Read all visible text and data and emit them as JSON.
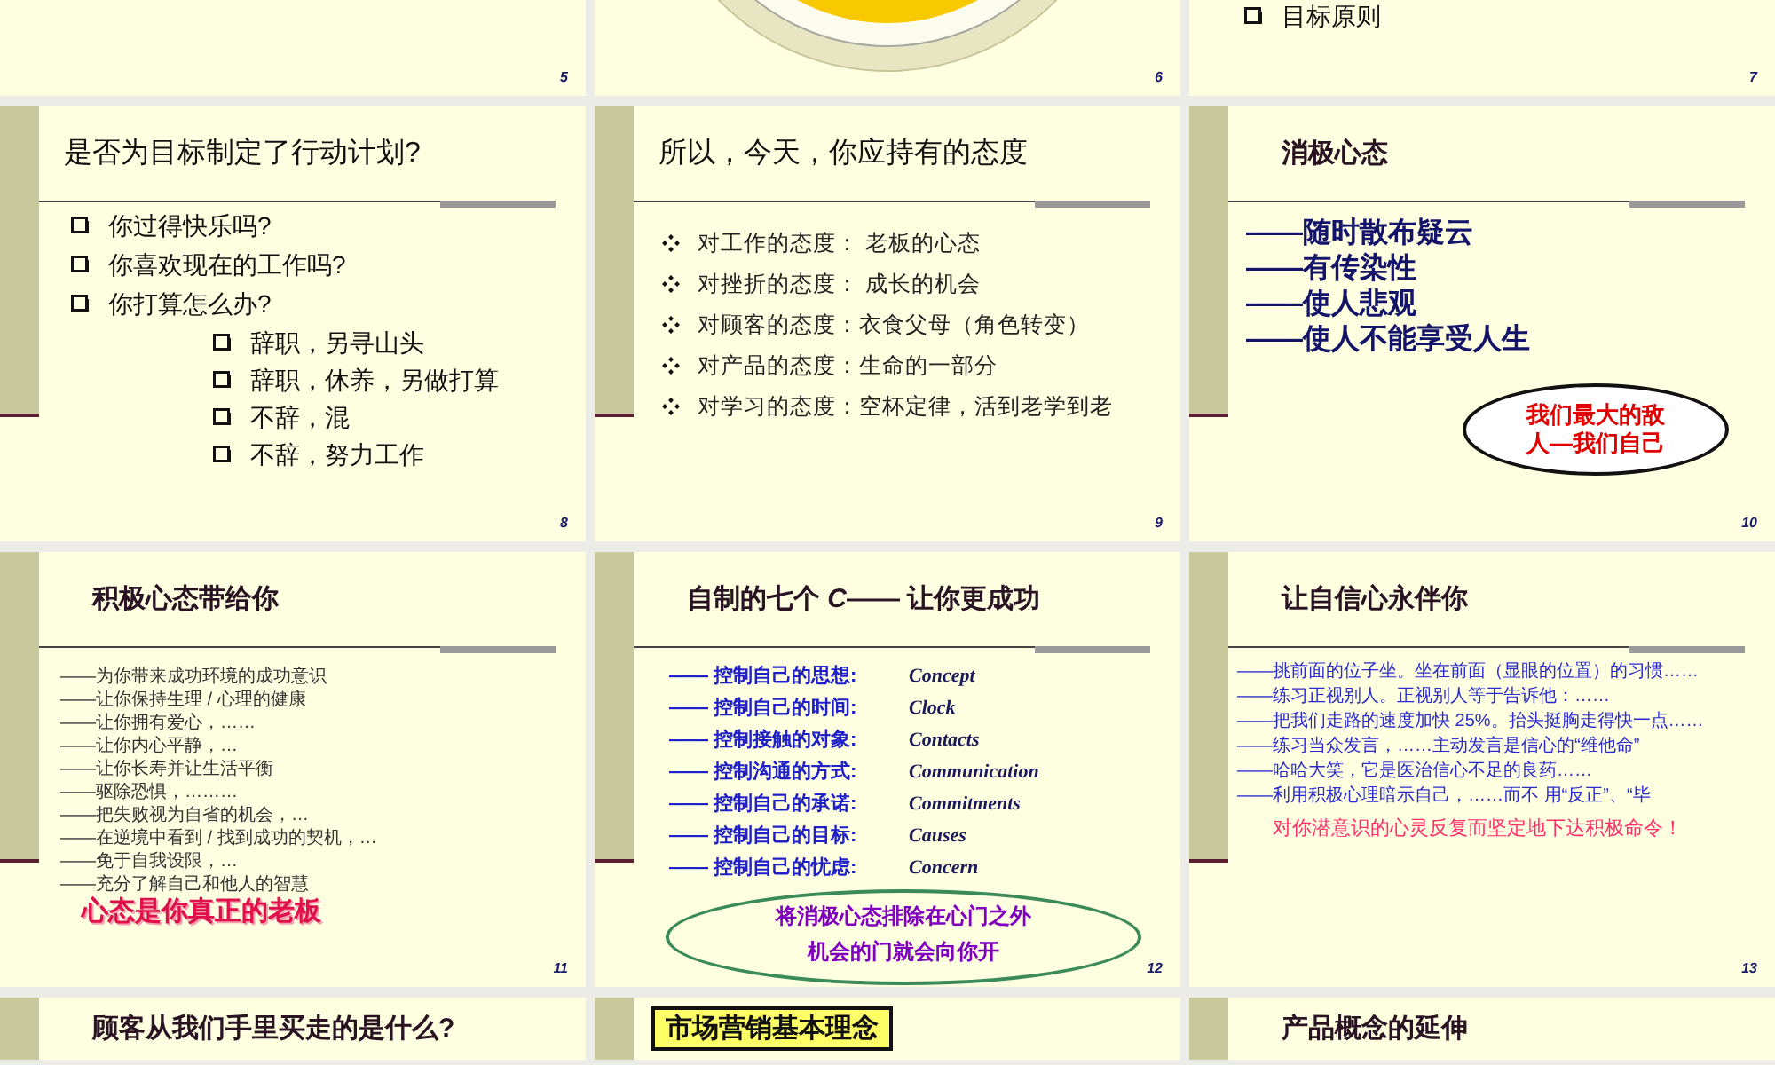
{
  "slides": [
    {
      "number": "5",
      "kind": "blank"
    },
    {
      "number": "6",
      "kind": "rings"
    },
    {
      "number": "7",
      "kind": "list",
      "body": {
        "kind": "medium",
        "items": [
          {
            "kind": "box-bullet",
            "text": "目标原则"
          }
        ]
      }
    },
    {
      "number": "8",
      "kind": "list",
      "title": {
        "kind": "plain",
        "text": "是否为目标制定了行动计划?"
      },
      "body": {
        "kind": "medium",
        "items": [
          {
            "kind": "box-bullet",
            "text": "你过得快乐吗?"
          },
          {
            "kind": "box-bullet",
            "text": "你喜欢现在的工作吗?"
          },
          {
            "kind": "box-bullet",
            "text": "你打算怎么办?",
            "children": [
              {
                "kind": "box-bullet",
                "text": "辞职，另寻山头"
              },
              {
                "kind": "box-bullet",
                "text": "辞职，休养，另做打算"
              },
              {
                "kind": "box-bullet",
                "text": "不辞，混"
              },
              {
                "kind": "box-bullet",
                "text": "不辞，努力工作"
              }
            ]
          }
        ]
      }
    },
    {
      "number": "9",
      "kind": "list",
      "title": {
        "kind": "plain",
        "text": "所以，今天，你应持有的态度"
      },
      "body": {
        "kind": "regular",
        "items": [
          {
            "kind": "diamond-bullet",
            "text": "对工作的态度： 老板的心态"
          },
          {
            "kind": "diamond-bullet",
            "text": "对挫折的态度： 成长的机会"
          },
          {
            "kind": "diamond-bullet",
            "text": "对顾客的态度：衣食父母（角色转变）"
          },
          {
            "kind": "diamond-bullet",
            "text": "对产品的态度：生命的一部分"
          },
          {
            "kind": "diamond-bullet",
            "text": "对学习的态度：空杯定律，活到老学到老"
          }
        ]
      }
    },
    {
      "number": "10",
      "kind": "list",
      "title": {
        "kind": "bold",
        "text": "消极心态"
      },
      "body": {
        "kind": "large-bold",
        "items": [
          {
            "kind": "dash",
            "text": "——随时散布疑云"
          },
          {
            "kind": "dash",
            "text": "——有传染性"
          },
          {
            "kind": "dash",
            "text": "——使人悲观"
          },
          {
            "kind": "dash",
            "text": "——使人不能享受人生"
          },
          {
            "kind": "oval-callout",
            "lines": [
              "我们最大的敌",
              "人—我们自己"
            ]
          }
        ]
      }
    },
    {
      "number": "11",
      "kind": "list",
      "title": {
        "kind": "bold",
        "text": "积极心态带给你"
      },
      "body": {
        "kind": "small",
        "items": [
          {
            "kind": "dash",
            "text": "——为你带来成功环境的成功意识"
          },
          {
            "kind": "dash",
            "text": "——让你保持生理 / 心理的健康"
          },
          {
            "kind": "dash",
            "text": "——让你拥有爱心，……"
          },
          {
            "kind": "dash",
            "text": "——让你内心平静，…"
          },
          {
            "kind": "dash",
            "text": "——让你长寿并让生活平衡"
          },
          {
            "kind": "dash",
            "text": "——驱除恐惧，………"
          },
          {
            "kind": "dash",
            "text": "——把失败视为自省的机会，…"
          },
          {
            "kind": "dash",
            "text": "——在逆境中看到 / 找到成功的契机，…"
          },
          {
            "kind": "dash",
            "text": "——免于自我设限，…"
          },
          {
            "kind": "dash",
            "text": "——充分了解自己和他人的智慧"
          },
          {
            "kind": "emphasis",
            "text": "心态是你真正的老板"
          }
        ]
      }
    },
    {
      "number": "12",
      "kind": "list",
      "title": {
        "kind": "bold",
        "text": "自制的七个 *C*—— 让你更成功"
      },
      "body": {
        "kind": "bold-blue",
        "items": [
          {
            "kind": "dash-term",
            "text": "—— 控制自己的思想:",
            "term": "Concept"
          },
          {
            "kind": "dash-term",
            "text": "—— 控制自己的时间:",
            "term": "Clock"
          },
          {
            "kind": "dash-term",
            "text": "—— 控制接触的对象:",
            "term": "Contacts"
          },
          {
            "kind": "dash-term",
            "text": "—— 控制沟通的方式:",
            "term": "Communication"
          },
          {
            "kind": "dash-term",
            "text": "—— 控制自己的承诺:",
            "term": "Commitments"
          },
          {
            "kind": "dash-term",
            "text": "—— 控制自己的目标:",
            "term": "Causes"
          },
          {
            "kind": "dash-term",
            "text": "—— 控制自己的忧虑:",
            "term": "Concern"
          },
          {
            "kind": "oval-banner",
            "lines": [
              "将消极心态排除在心门之外",
              "机会的门就会向你开"
            ]
          }
        ]
      }
    },
    {
      "number": "13",
      "kind": "list",
      "title": {
        "kind": "bold",
        "text": "让自信心永伴你"
      },
      "body": {
        "kind": "small-blue",
        "items": [
          {
            "kind": "dash",
            "text": "——挑前面的位子坐。坐在前面（显眼的位置）的习惯……"
          },
          {
            "kind": "dash",
            "text": "——练习正视别人。正视别人等于告诉他：……"
          },
          {
            "kind": "dash",
            "text": "——把我们走路的速度加快 25%。抬头挺胸走得快一点……"
          },
          {
            "kind": "dash",
            "text": "——练习当众发言，……主动发言是信心的“维他命”"
          },
          {
            "kind": "dash",
            "text": "——哈哈大笑，它是医治信心不足的良药……"
          },
          {
            "kind": "dash",
            "text": "——利用积极心理暗示自己，……而不 用“反正”、“毕"
          },
          {
            "kind": "highlight",
            "text": "对你潜意识的心灵反复而坚定地下达积极命令！"
          }
        ]
      }
    },
    {
      "kind": "list",
      "title": {
        "kind": "bold",
        "text": "顾客从我们手里买走的是什么?"
      }
    },
    {
      "kind": "list",
      "title": {
        "kind": "boxed",
        "text": "市场营销基本理念"
      }
    },
    {
      "kind": "list",
      "title": {
        "kind": "bold",
        "text": "产品概念的延伸"
      }
    }
  ]
}
